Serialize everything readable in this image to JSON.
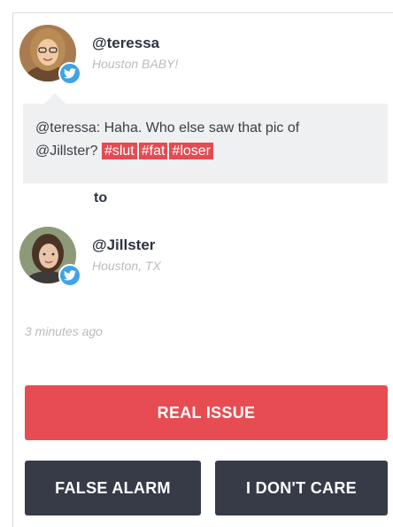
{
  "sender": {
    "handle": "@teressa",
    "location": "Houston BABY!",
    "avatar_icon": "avatar-teressa",
    "badge_icon": "twitter-bird-icon"
  },
  "message": {
    "text": "@teressa: Haha. Who else saw that pic of @Jillster?",
    "text_line1": "@teressa: Haha. Who else saw that pic of",
    "text_line2": "@Jillster?",
    "hashtags": [
      "#slut",
      "#fat",
      "#loser"
    ],
    "highlight_color": "#e44b52"
  },
  "to_label": "to",
  "recipient": {
    "handle": "@Jillster",
    "location": "Houston, TX",
    "avatar_icon": "avatar-jillster",
    "badge_icon": "twitter-bird-icon"
  },
  "timestamp": "3 minutes ago",
  "actions": {
    "real_issue": "REAL ISSUE",
    "false_alarm": "FALSE ALARM",
    "dont_care": "I DON'T CARE"
  },
  "colors": {
    "real_issue_bg": "#e84c53",
    "secondary_bg": "#363b47",
    "badge": "#3fa3e6"
  }
}
